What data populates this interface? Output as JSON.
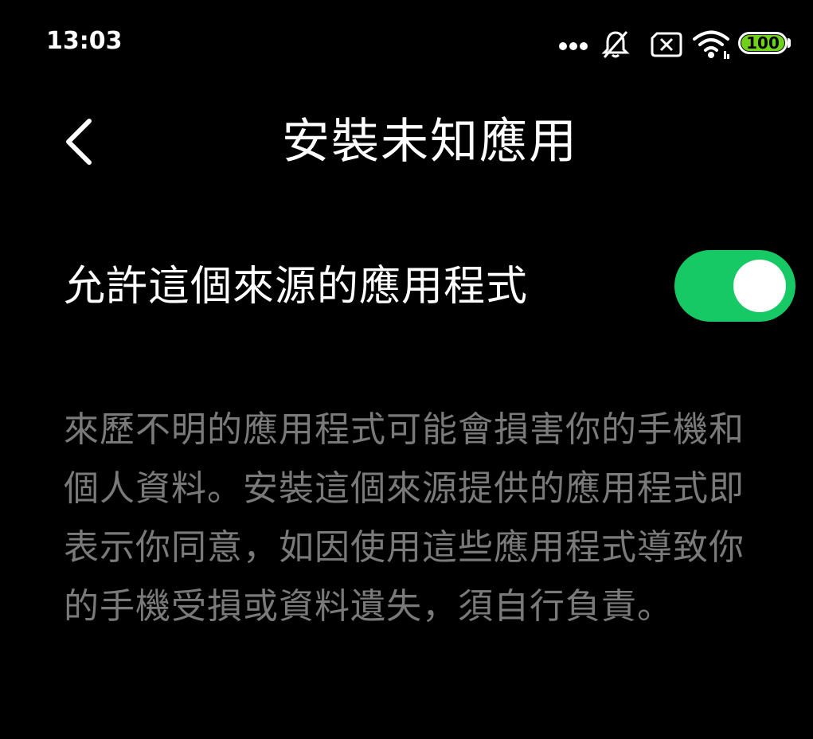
{
  "status_bar": {
    "time": "13:03",
    "battery_level": "100",
    "icons": [
      "more-dots-icon",
      "mute-icon",
      "no-sim-icon",
      "wifi-icon",
      "battery-icon"
    ],
    "battery_color": "#6fd11a"
  },
  "header": {
    "title": "安裝未知應用",
    "back_icon": "back-chevron-icon"
  },
  "setting": {
    "label": "允許這個來源的應用程式",
    "toggle_on": true,
    "toggle_color": "#17c964"
  },
  "description": "來歷不明的應用程式可能會損害你的手機和個人資料。安裝這個來源提供的應用程式即表示你同意，如因使用這些應用程式導致你的手機受損或資料遺失，須自行負責。"
}
